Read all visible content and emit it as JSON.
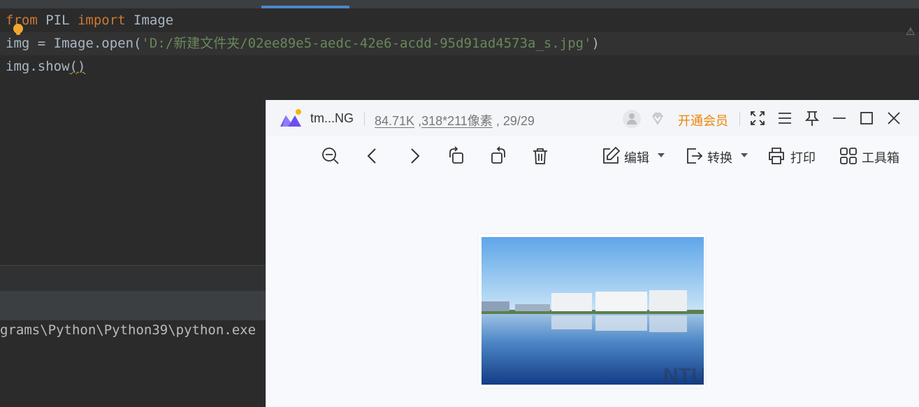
{
  "editor": {
    "lines": [
      {
        "tokens": [
          [
            "kw",
            "from"
          ],
          [
            "plain",
            " PIL "
          ],
          [
            "kw",
            "import"
          ],
          [
            "plain",
            " Image"
          ]
        ]
      },
      {
        "tokens": [
          [
            "plain",
            "img = Image.open("
          ],
          [
            "str",
            "'D:/新建文件夹/02ee89e5-aedc-42e6-acdd-95d91ad4573a_s.jpg'"
          ],
          [
            "plain",
            ")"
          ]
        ]
      },
      {
        "tokens": [
          [
            "plain",
            "img.show"
          ],
          [
            "squiggle",
            "()"
          ]
        ]
      }
    ],
    "icons": {
      "intention": "lightbulb-icon",
      "warning": "warning-icon"
    }
  },
  "console": {
    "output": "grams\\Python\\Python39\\python.exe"
  },
  "viewer": {
    "title": "tm...NG",
    "file_size": "84.71K",
    "dimensions": "318*211像素",
    "page_counter": "29/29",
    "vip_label": "开通会员",
    "toolbar": {
      "edit": "编辑",
      "convert": "转换",
      "print": "打印",
      "toolbox": "工具箱"
    },
    "watermark": "NTU",
    "colors": {
      "accent": "#f08300",
      "logo_purple": "#6b4ef0",
      "logo_yellow": "#f7b500"
    }
  }
}
